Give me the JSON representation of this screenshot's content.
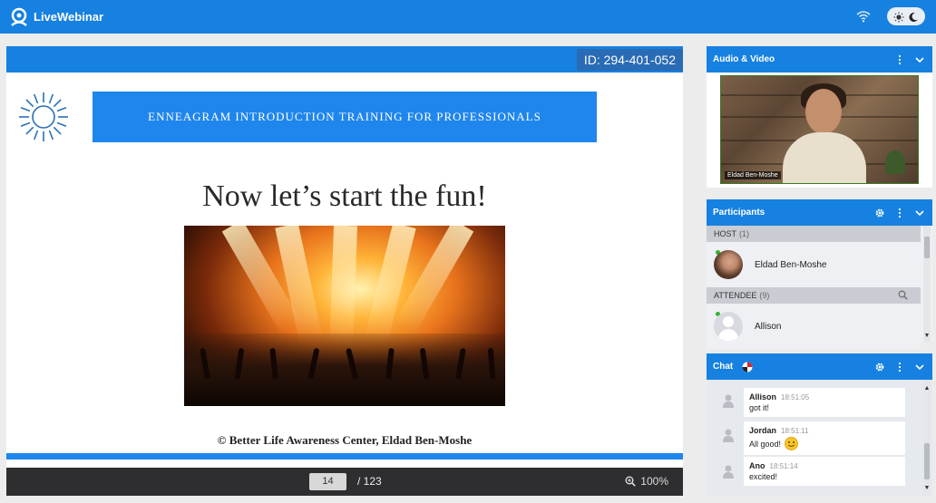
{
  "app": {
    "logo_text": "LiveWebinar"
  },
  "topbar": {
    "icons": [
      "wifi-icon",
      "light-mode-icon",
      "dark-mode-icon"
    ]
  },
  "presentation": {
    "id_label": "ID: 294-401-052",
    "slide": {
      "banner_text": "ENNEAGRAM INTRODUCTION TRAINING FOR PROFESSIONALS",
      "title": "Now let’s start the fun!",
      "copyright": "© Better Life Awareness Center, Eldad Ben-Moshe"
    },
    "controls": {
      "current_page": "14",
      "total_pages": "/ 123",
      "zoom": "100%"
    }
  },
  "audio_video": {
    "title": "Audio & Video",
    "video_name": "Eldad Ben-Moshe"
  },
  "participants": {
    "title": "Participants",
    "host_group": {
      "label": "HOST",
      "count": "(1)"
    },
    "hosts": [
      {
        "name": "Eldad Ben-Moshe"
      }
    ],
    "attendee_group": {
      "label": "ATTENDEE",
      "count": "(9)"
    },
    "attendees": [
      {
        "name": "Allison"
      }
    ]
  },
  "chat": {
    "title": "Chat",
    "messages": [
      {
        "author": "Allison",
        "time": "18:51:05",
        "text": "got it!"
      },
      {
        "author": "Jordan",
        "time": "18:51:11",
        "text": "All good!"
      },
      {
        "author": "Ano",
        "time": "18:51:14",
        "text": "excited!"
      }
    ]
  },
  "colors": {
    "brand_blue": "#1681e0",
    "banner_blue": "#1f86ee",
    "dark_controls": "#2e2e30",
    "online_green": "#2fb52f"
  }
}
